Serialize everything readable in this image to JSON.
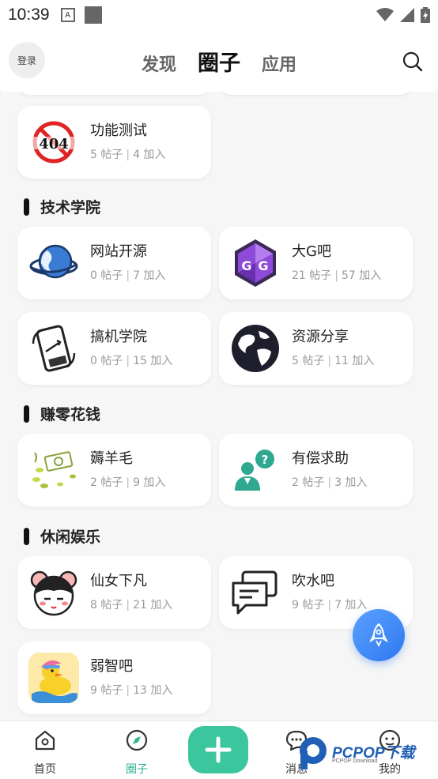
{
  "status_bar": {
    "time": "10:39"
  },
  "header": {
    "login_label": "登录",
    "tabs": [
      {
        "label": "发现"
      },
      {
        "label": "圈子"
      },
      {
        "label": "应用"
      }
    ]
  },
  "top_card": {
    "title": "功能测试",
    "posts": "5 帖子",
    "joins": "4 加入"
  },
  "sections": [
    {
      "title": "技术学院",
      "cards": [
        {
          "title": "网站开源",
          "posts": "0 帖子",
          "joins": "7 加入",
          "icon": "globe-icon"
        },
        {
          "title": "大G吧",
          "posts": "21 帖子",
          "joins": "57 加入",
          "icon": "gg-logo-icon"
        },
        {
          "title": "搞机学院",
          "posts": "0 帖子",
          "joins": "15 加入",
          "icon": "phone-rotate-icon"
        },
        {
          "title": "资源分享",
          "posts": "5 帖子",
          "joins": "11 加入",
          "icon": "earth-icon"
        }
      ]
    },
    {
      "title": "赚零花钱",
      "cards": [
        {
          "title": "薅羊毛",
          "posts": "2 帖子",
          "joins": "9 加入",
          "icon": "money-icon"
        },
        {
          "title": "有偿求助",
          "posts": "2 帖子",
          "joins": "3 加入",
          "icon": "help-person-icon"
        }
      ]
    },
    {
      "title": "休闲娱乐",
      "cards": [
        {
          "title": "仙女下凡",
          "posts": "8 帖子",
          "joins": "21 加入",
          "icon": "girl-face-icon"
        },
        {
          "title": "吹水吧",
          "posts": "9 帖子",
          "joins": "7 加入",
          "icon": "chat-bubbles-icon"
        },
        {
          "title": "弱智吧",
          "posts": "9 帖子",
          "joins": "13 加入",
          "icon": "duck-icon"
        }
      ]
    }
  ],
  "bottom_nav": [
    {
      "label": "首页",
      "icon": "home-icon"
    },
    {
      "label": "圈子",
      "icon": "compass-icon"
    },
    {
      "label": "消息",
      "icon": "message-icon"
    },
    {
      "label": "我的",
      "icon": "profile-icon"
    }
  ],
  "watermark": {
    "text": "PCPOP下载",
    "sub": "PCPOP Download"
  },
  "colors": {
    "accent_green": "#3cc69d",
    "fab_blue": "#3a86f5",
    "active_nav": "#2eb38f"
  }
}
